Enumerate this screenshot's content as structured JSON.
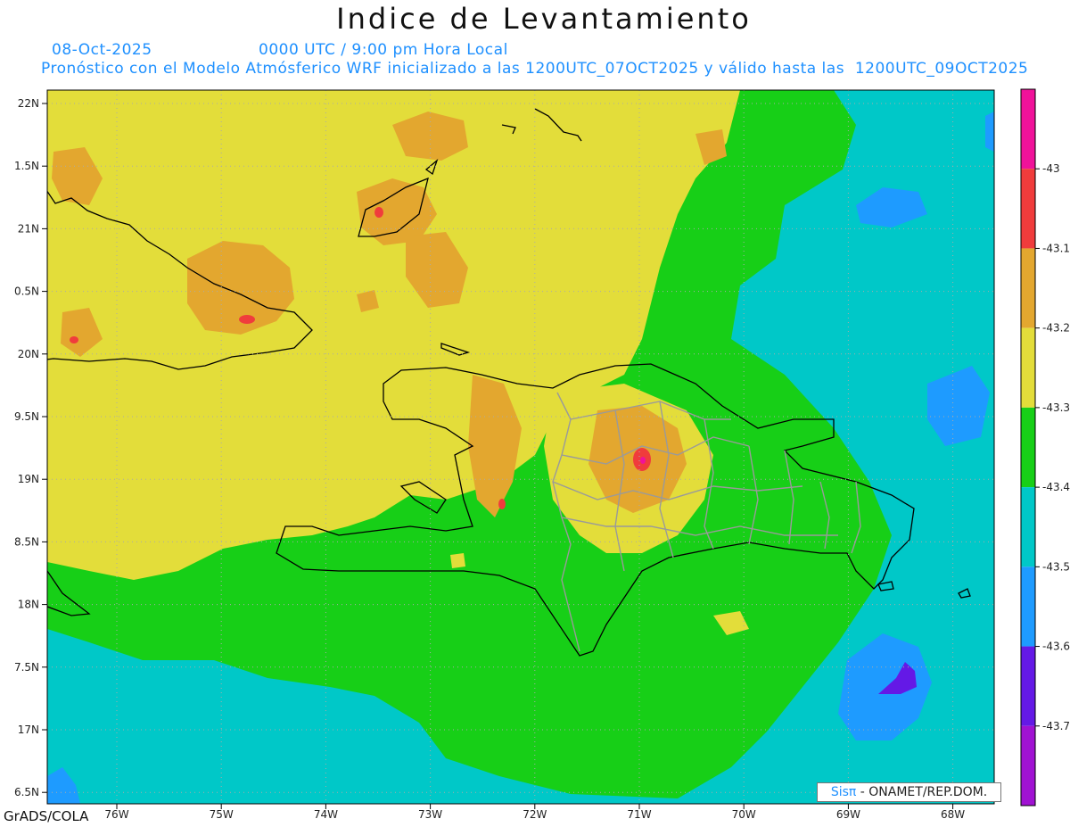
{
  "title": "Indice de Levantamiento",
  "date": "08-Oct-2025",
  "time_label": "0000 UTC / 9:00 pm Hora Local",
  "subtitle": "Pronóstico con el Modelo Atmósferico WRF inicializado a las 1200UTC_07OCT2025 y válido hasta las  1200UTC_09OCT2025",
  "credit": "GrADS/COLA",
  "logo": {
    "sis": "Sisπ",
    "rest": " - ONAMET/REP.DOM."
  },
  "lat_labels": [
    "22N",
    "1.5N",
    "21N",
    "0.5N",
    "20N",
    "9.5N",
    "19N",
    "8.5N",
    "18N",
    "7.5N",
    "17N",
    "6.5N"
  ],
  "lon_labels": [
    "76W",
    "75W",
    "74W",
    "73W",
    "72W",
    "71W",
    "70W",
    "69W",
    "68W"
  ],
  "colorbar": {
    "colors": [
      "#f0129a",
      "#f03c3c",
      "#e3a72f",
      "#e3dd3a",
      "#17cf17",
      "#00c8c8",
      "#1e9bff",
      "#6419e6",
      "#a012d2"
    ],
    "labels": [
      "-43",
      "-43.1",
      "-43.2",
      "-43.3",
      "-43.4",
      "-43.5",
      "-43.6",
      "-43.7"
    ]
  }
}
